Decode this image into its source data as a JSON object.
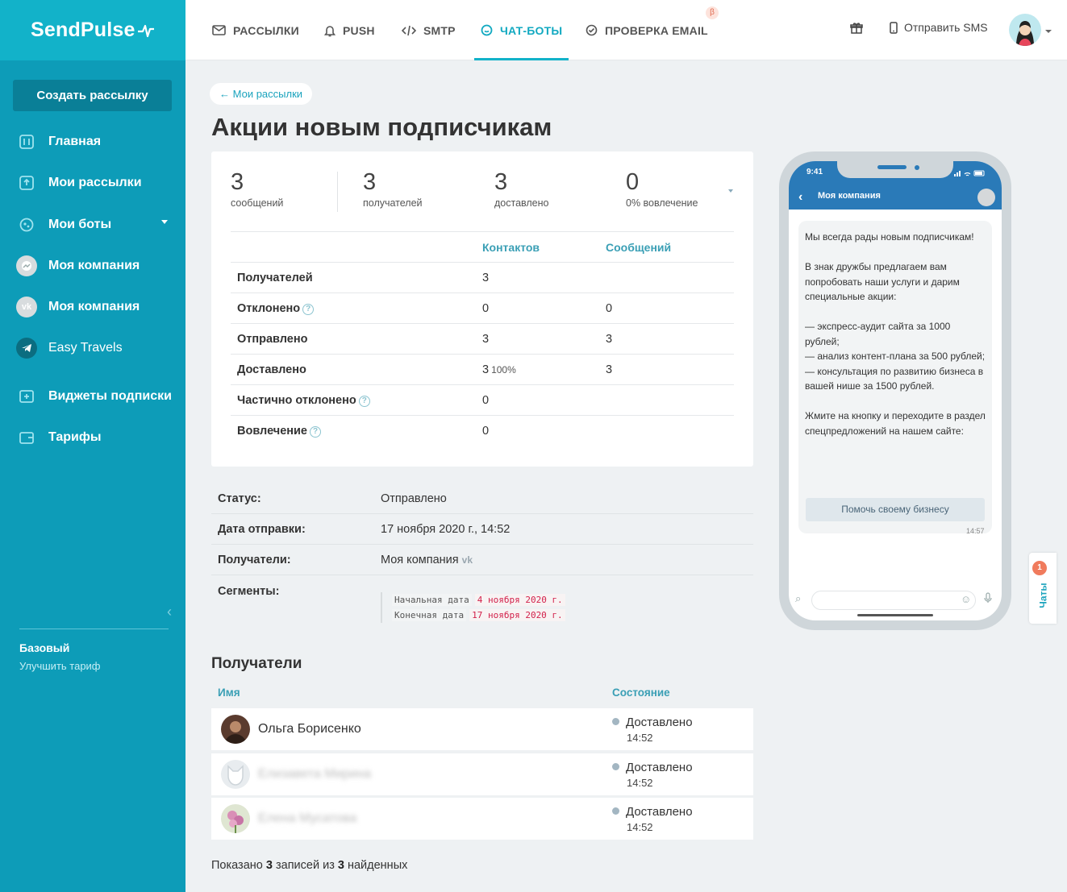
{
  "brand": {
    "name": "SendPulse"
  },
  "sidebar": {
    "create_button": "Создать рассылку",
    "items": [
      {
        "label": "Главная",
        "icon": "sliders-icon"
      },
      {
        "label": "Мои рассылки",
        "icon": "upload-icon"
      },
      {
        "label": "Мои боты",
        "icon": "bot-icon"
      },
      {
        "label": "Моя компания",
        "icon": "messenger-icon"
      },
      {
        "label": "Моя компания",
        "icon": "vk-icon"
      },
      {
        "label": "Easy Travels",
        "icon": "telegram-icon"
      },
      {
        "label": "Виджеты подписки",
        "icon": "widget-icon"
      },
      {
        "label": "Тарифы",
        "icon": "wallet-icon"
      }
    ],
    "plan": "Базовый",
    "upgrade": "Улучшить тариф"
  },
  "header": {
    "tabs": [
      {
        "label": "РАССЫЛКИ",
        "icon": "mail-icon"
      },
      {
        "label": "PUSH",
        "icon": "bell-icon"
      },
      {
        "label": "SMTP",
        "icon": "code-icon"
      },
      {
        "label": "ЧАТ-БОТЫ",
        "icon": "chat-icon"
      },
      {
        "label": "ПРОВЕРКА EMAIL",
        "icon": "check-circle-icon"
      }
    ],
    "beta": "β",
    "send_sms": "Отправить SMS"
  },
  "page": {
    "back": "← Мои рассылки",
    "title": "Акции новым подписчикам"
  },
  "stats": [
    {
      "value": "3",
      "label": "сообщений"
    },
    {
      "value": "3",
      "label": "получателей"
    },
    {
      "value": "3",
      "label": "доставлено"
    },
    {
      "value": "0",
      "label": "0% вовлечение"
    }
  ],
  "stats_table": {
    "headers": [
      "Контактов",
      "Сообщений"
    ],
    "rows": [
      {
        "label": "Получателей",
        "contacts": "3",
        "messages": ""
      },
      {
        "label": "Отклонено",
        "contacts": "0",
        "messages": "0",
        "help": "?"
      },
      {
        "label": "Отправлено",
        "contacts": "3",
        "messages": "3"
      },
      {
        "label": "Доставлено",
        "contacts": "3",
        "pct": "100%",
        "messages": "3"
      },
      {
        "label": "Частично отклонено",
        "contacts": "0",
        "messages": "",
        "help": "?"
      },
      {
        "label": "Вовлечение",
        "contacts": "0",
        "messages": "",
        "help": "?"
      }
    ]
  },
  "info": {
    "status_label": "Статус:",
    "status": "Отправлено",
    "date_label": "Дата отправки:",
    "date": "17 ноября 2020 г., 14:52",
    "recipients_label": "Получатели:",
    "recipients": "Моя компания",
    "segments_label": "Сегменты:",
    "segments": [
      {
        "key": "Начальная дата",
        "value": "4 ноября 2020 г."
      },
      {
        "key": "Конечная дата",
        "value": "17 ноября 2020 г."
      }
    ]
  },
  "recipients": {
    "title": "Получатели",
    "col_name": "Имя",
    "col_state": "Состояние",
    "rows": [
      {
        "name": "Ольга Борисенко",
        "state": "Доставлено",
        "time": "14:52"
      },
      {
        "name": "Елизавета Мирина",
        "state": "Доставлено",
        "time": "14:52"
      },
      {
        "name": "Елена Мусатова",
        "state": "Доставлено",
        "time": "14:52"
      }
    ],
    "footer_pre": "Показано ",
    "footer_count": "3",
    "footer_mid": " записей из ",
    "footer_total": "3",
    "footer_post": " найденных"
  },
  "phone": {
    "time": "9:41",
    "chat_name": "Моя компания",
    "message": "Мы всегда рады новым подписчикам!\n\nВ знак дружбы предлагаем вам попробовать наши услуги и дарим специальные акции:\n\n— экспресс-аудит сайта за 1000 рублей;\n— анализ контент-плана за 500 рублей;\n— консультация по развитию бизнеса в вашей нише за 1500 рублей.\n\nЖмите на кнопку и переходите в раздел спецпредложений на нашем сайте:",
    "button": "Помочь своему бизнесу",
    "msg_time": "14:57"
  },
  "chats_widget": {
    "label": "Чаты",
    "badge": "1"
  },
  "colors": {
    "sidebar": "#0d9cb8",
    "accent": "#12b2c9",
    "phone_header": "#2a7ab8",
    "segment_value": "#d2204a"
  }
}
